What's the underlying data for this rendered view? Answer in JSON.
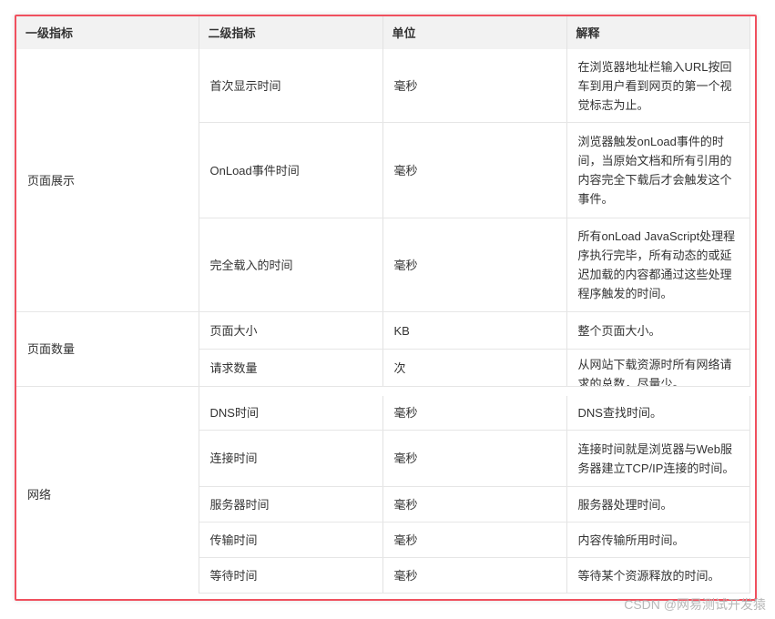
{
  "table": {
    "headers": [
      "一级指标",
      "二级指标",
      "单位",
      "解释"
    ],
    "groups": {
      "page_display": "页面展示",
      "page_count": "页面数量",
      "network": "网络"
    },
    "rows": [
      {
        "metric": "首次显示时间",
        "unit": "毫秒",
        "desc": "在浏览器地址栏输入URL按回车到用户看到网页的第一个视觉标志为止。"
      },
      {
        "metric": "OnLoad事件时间",
        "unit": "毫秒",
        "desc": "浏览器触发onLoad事件的时间，当原始文档和所有引用的内容完全下载后才会触发这个事件。"
      },
      {
        "metric": "完全载入的时间",
        "unit": "毫秒",
        "desc": "所有onLoad JavaScript处理程序执行完毕，所有动态的或延迟加载的内容都通过这些处理程序触发的时间。"
      },
      {
        "metric": "页面大小",
        "unit": "KB",
        "desc": "整个页面大小。"
      },
      {
        "metric": "请求数量",
        "unit": "次",
        "desc": "从网站下载资源时所有网络请求的总数，尽量少。"
      },
      {
        "metric": "DNS时间",
        "unit": "毫秒",
        "desc": "DNS查找时间。"
      },
      {
        "metric": "连接时间",
        "unit": "毫秒",
        "desc": "连接时间就是浏览器与Web服务器建立TCP/IP连接的时间。"
      },
      {
        "metric": "服务器时间",
        "unit": "毫秒",
        "desc": "服务器处理时间。"
      },
      {
        "metric": "传输时间",
        "unit": "毫秒",
        "desc": "内容传输所用时间。"
      },
      {
        "metric": "等待时间",
        "unit": "毫秒",
        "desc": "等待某个资源释放的时间。"
      }
    ]
  },
  "watermark": "CSDN @网易测试开发猿",
  "colors": {
    "frame_border": "#f0505e",
    "header_bg": "#f2f2f2"
  }
}
